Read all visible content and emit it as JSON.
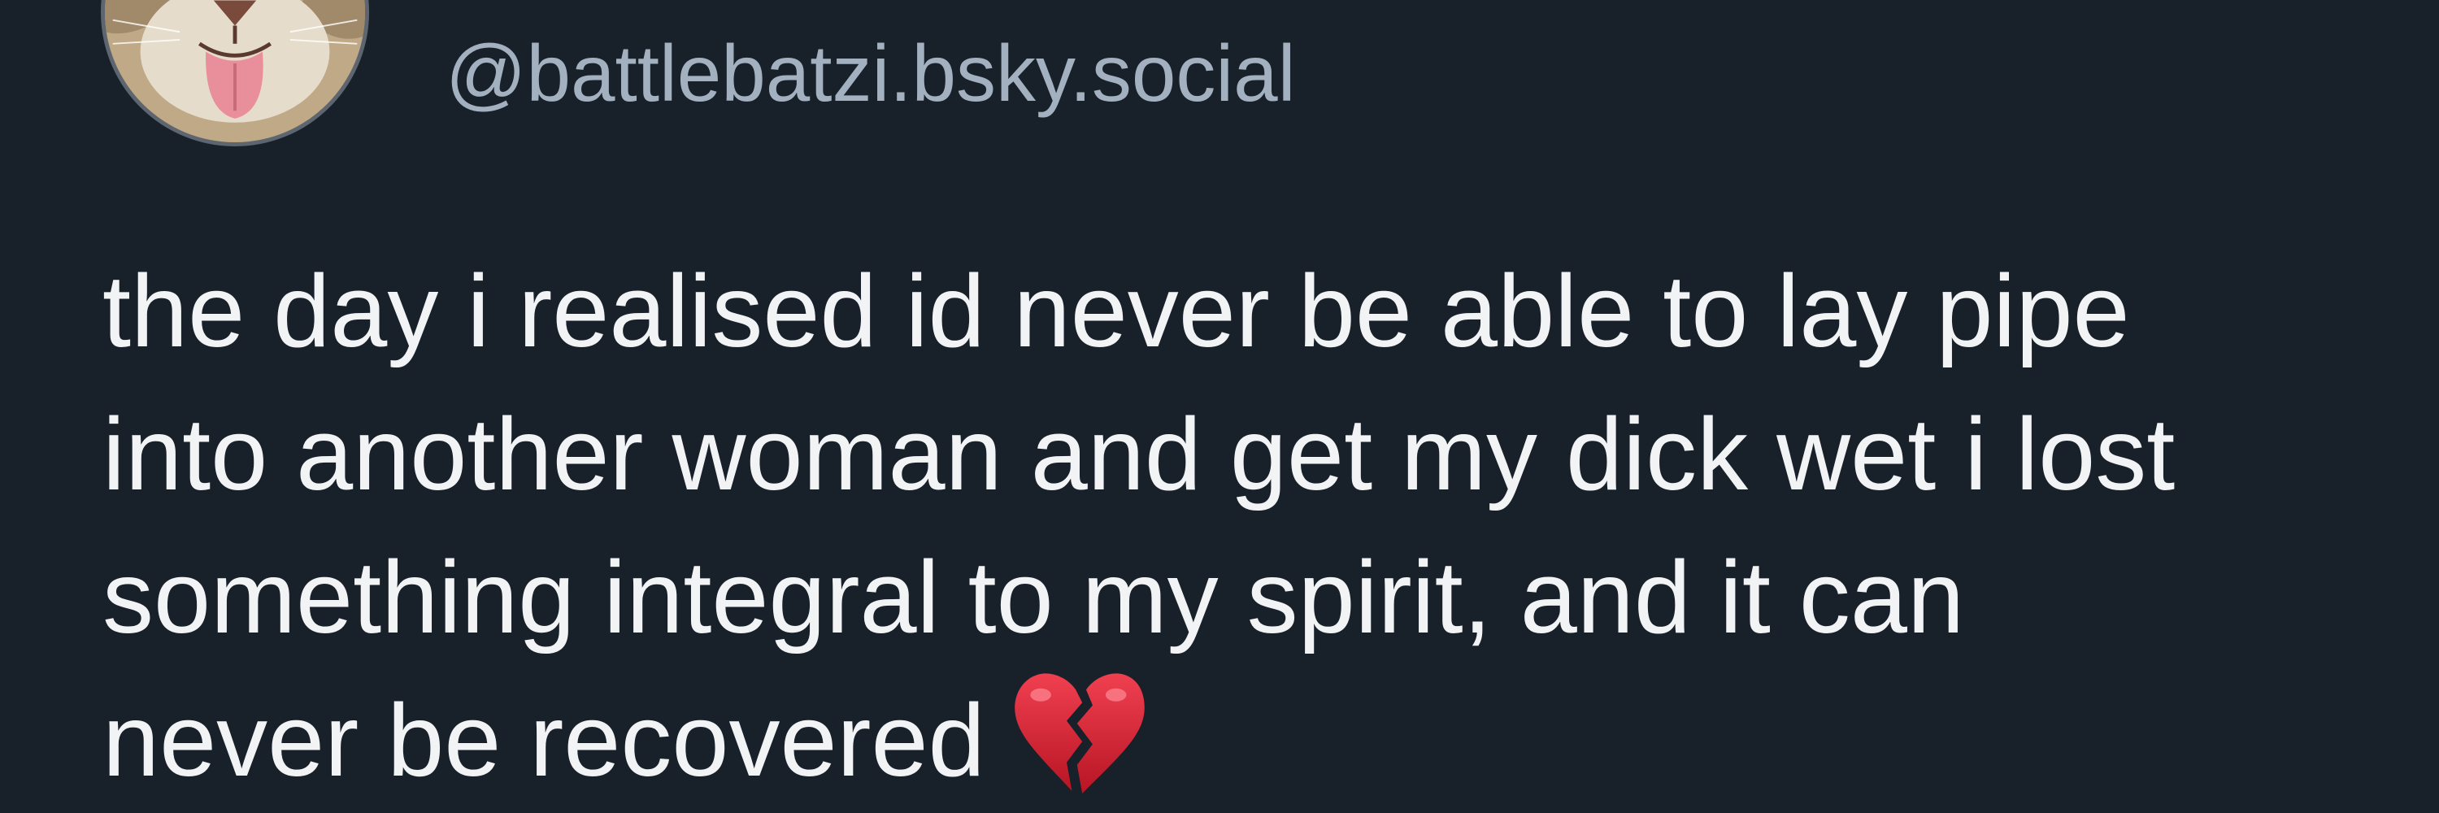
{
  "author": {
    "handle": "@battlebatzi.bsky.social",
    "avatar_icon": "cat-avatar"
  },
  "post": {
    "lines": [
      "the day i realised id never be able to lay pipe",
      "into another woman and get my dick wet i lost",
      "something integral to my spirit, and it can",
      "never be recovered"
    ],
    "emoji_icon": "broken-heart-icon"
  },
  "colors": {
    "background": "#18202a",
    "handle": "#a2b0c0",
    "text": "#f1f3f5",
    "heart": "#d8212f"
  }
}
